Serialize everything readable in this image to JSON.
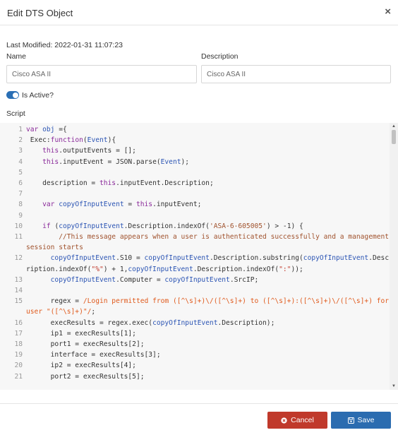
{
  "dialog": {
    "title": "Edit DTS Object",
    "close_symbol": "×"
  },
  "meta": {
    "last_modified": "Last Modified: 2022-01-31 11:07:23"
  },
  "fields": {
    "name_label": "Name",
    "name_value": "Cisco ASA II",
    "description_label": "Description",
    "description_value": "Cisco ASA II"
  },
  "toggle": {
    "label": "Is Active?",
    "checked": true
  },
  "script": {
    "label": "Script",
    "lines": [
      {
        "n": "1",
        "parts": [
          [
            "k",
            "var "
          ],
          [
            "v",
            "obj"
          ],
          [
            "n",
            " ={"
          ]
        ]
      },
      {
        "n": "2",
        "parts": [
          [
            "n",
            " Exec:"
          ],
          [
            "k",
            "function"
          ],
          [
            "n",
            "("
          ],
          [
            "v",
            "Event"
          ],
          [
            "n",
            "){"
          ]
        ]
      },
      {
        "n": "3",
        "parts": [
          [
            "n",
            "    "
          ],
          [
            "k",
            "this"
          ],
          [
            "n",
            ".outputEvents = [];"
          ]
        ]
      },
      {
        "n": "4",
        "parts": [
          [
            "n",
            "    "
          ],
          [
            "k",
            "this"
          ],
          [
            "n",
            ".inputEvent = JSON.parse("
          ],
          [
            "v",
            "Event"
          ],
          [
            "n",
            ");"
          ]
        ]
      },
      {
        "n": "5",
        "parts": []
      },
      {
        "n": "6",
        "parts": [
          [
            "n",
            "    description = "
          ],
          [
            "k",
            "this"
          ],
          [
            "n",
            ".inputEvent.Description;"
          ]
        ]
      },
      {
        "n": "7",
        "parts": []
      },
      {
        "n": "8",
        "parts": [
          [
            "n",
            "    "
          ],
          [
            "k",
            "var "
          ],
          [
            "v",
            "copyOfInputEvent"
          ],
          [
            "n",
            " = "
          ],
          [
            "k",
            "this"
          ],
          [
            "n",
            ".inputEvent;"
          ]
        ]
      },
      {
        "n": "9",
        "parts": []
      },
      {
        "n": "10",
        "parts": [
          [
            "n",
            "    "
          ],
          [
            "k",
            "if"
          ],
          [
            "n",
            " ("
          ],
          [
            "v",
            "copyOfInputEvent"
          ],
          [
            "n",
            ".Description.indexOf("
          ],
          [
            "s",
            "'ASA-6-605005'"
          ],
          [
            "n",
            ") > -1) {"
          ]
        ]
      },
      {
        "n": "11",
        "parts": [
          [
            "c",
            "        //This message appears when a user is authenticated successfully and a management session starts"
          ]
        ]
      },
      {
        "n": "12",
        "parts": [
          [
            "n",
            "      "
          ],
          [
            "v",
            "copyOfInputEvent"
          ],
          [
            "n",
            ".S10 = "
          ],
          [
            "v",
            "copyOfInputEvent"
          ],
          [
            "n",
            ".Description.substring("
          ],
          [
            "v",
            "copyOfInputEvent"
          ],
          [
            "n",
            ".Description.indexOf("
          ],
          [
            "s2",
            "\"%\""
          ],
          [
            "n",
            ") + 1,"
          ],
          [
            "v",
            "copyOfInputEvent"
          ],
          [
            "n",
            ".Description.indexOf("
          ],
          [
            "s2",
            "\":\""
          ],
          [
            "n",
            "));"
          ]
        ]
      },
      {
        "n": "13",
        "parts": [
          [
            "n",
            "      "
          ],
          [
            "v",
            "copyOfInputEvent"
          ],
          [
            "n",
            ".Computer = "
          ],
          [
            "v",
            "copyOfInputEvent"
          ],
          [
            "n",
            ".SrcIP;"
          ]
        ]
      },
      {
        "n": "14",
        "parts": []
      },
      {
        "n": "15",
        "parts": [
          [
            "n",
            "      regex = "
          ],
          [
            "re",
            "/Login permitted from ([^\\s]+)\\/([^\\s]+) to ([^\\s]+):([^\\s]+)\\/([^\\s]+) for user \"([^\\s]+)\"/"
          ],
          [
            "n",
            ";"
          ]
        ]
      },
      {
        "n": "16",
        "parts": [
          [
            "n",
            "      execResults = regex.exec("
          ],
          [
            "v",
            "copyOfInputEvent"
          ],
          [
            "n",
            ".Description);"
          ]
        ]
      },
      {
        "n": "17",
        "parts": [
          [
            "n",
            "      ip1 = execResults[1];"
          ]
        ]
      },
      {
        "n": "18",
        "parts": [
          [
            "n",
            "      port1 = execResults[2];"
          ]
        ]
      },
      {
        "n": "19",
        "parts": [
          [
            "n",
            "      interface = execResults[3];"
          ]
        ]
      },
      {
        "n": "20",
        "parts": [
          [
            "n",
            "      ip2 = execResults[4];"
          ]
        ]
      },
      {
        "n": "21",
        "parts": [
          [
            "n",
            "      port2 = execResults[5];"
          ]
        ]
      }
    ]
  },
  "buttons": {
    "cancel": "Cancel",
    "save": "Save"
  },
  "colors": {
    "cancel": "#c0392b",
    "save": "#2b6cb0",
    "toggle": "#2a6fb5"
  }
}
